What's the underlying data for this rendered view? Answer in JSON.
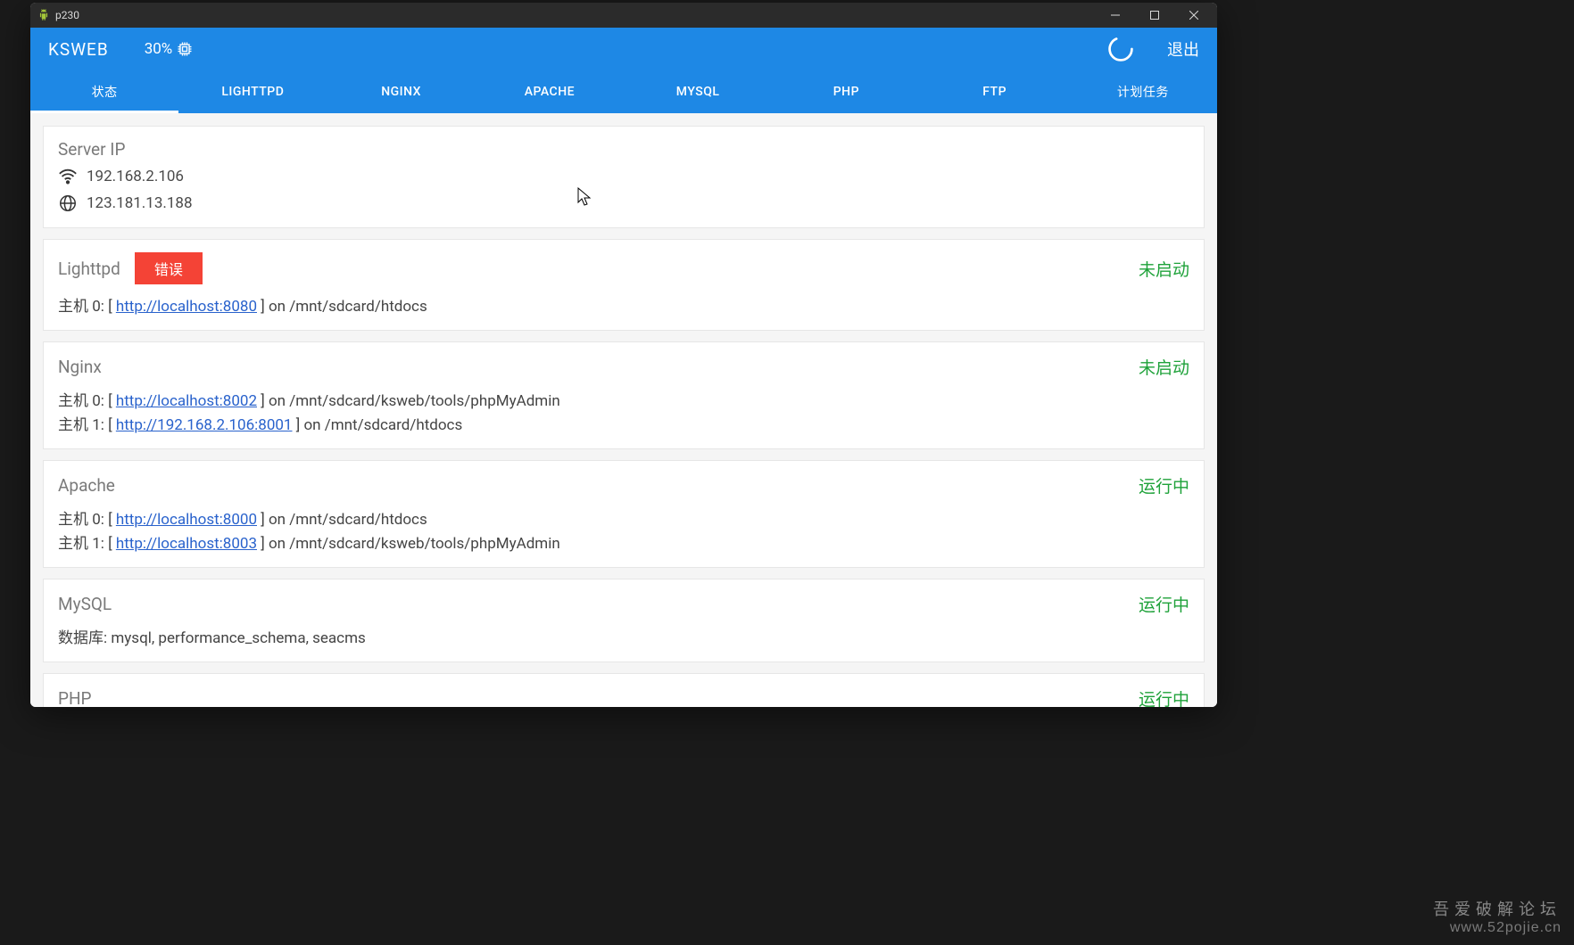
{
  "window": {
    "title": "p230"
  },
  "appbar": {
    "title": "KSWEB",
    "cpu_pct": "30%",
    "exit_label": "退出"
  },
  "tabs": [
    {
      "label": "状态",
      "active": true
    },
    {
      "label": "LIGHTTPD",
      "active": false
    },
    {
      "label": "NGINX",
      "active": false
    },
    {
      "label": "APACHE",
      "active": false
    },
    {
      "label": "MYSQL",
      "active": false
    },
    {
      "label": "PHP",
      "active": false
    },
    {
      "label": "FTP",
      "active": false
    },
    {
      "label": "计划任务",
      "active": false
    }
  ],
  "server_ip": {
    "title": "Server IP",
    "wifi": "192.168.2.106",
    "public": "123.181.13.188"
  },
  "services": {
    "lighttpd": {
      "title": "Lighttpd",
      "error_badge": "错误",
      "status": "未启动",
      "hosts": [
        {
          "prefix": "主机 0: [ ",
          "url": "http://localhost:8080",
          "suffix": " ] on /mnt/sdcard/htdocs"
        }
      ]
    },
    "nginx": {
      "title": "Nginx",
      "status": "未启动",
      "hosts": [
        {
          "prefix": "主机 0: [ ",
          "url": "http://localhost:8002",
          "suffix": " ] on /mnt/sdcard/ksweb/tools/phpMyAdmin"
        },
        {
          "prefix": "主机 1: [ ",
          "url": "http://192.168.2.106:8001",
          "suffix": " ] on /mnt/sdcard/htdocs"
        }
      ]
    },
    "apache": {
      "title": "Apache",
      "status": "运行中",
      "hosts": [
        {
          "prefix": "主机 0: [ ",
          "url": "http://localhost:8000",
          "suffix": " ] on /mnt/sdcard/htdocs"
        },
        {
          "prefix": "主机 1: [ ",
          "url": "http://localhost:8003",
          "suffix": " ] on /mnt/sdcard/ksweb/tools/phpMyAdmin"
        }
      ]
    },
    "mysql": {
      "title": "MySQL",
      "status": "运行中",
      "db_label": "数据库: ",
      "db_list": "mysql, performance_schema, seacms"
    },
    "php": {
      "title": "PHP",
      "status": "运行中"
    }
  },
  "watermark": {
    "line1": "吾爱破解论坛",
    "line2": "www.52pojie.cn"
  }
}
